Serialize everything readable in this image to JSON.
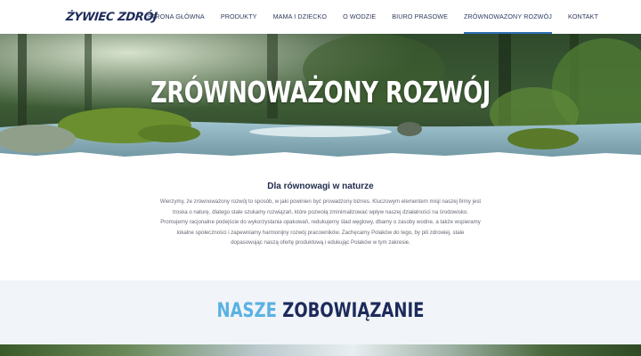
{
  "brand": {
    "logo_text": "ŻYWIEC ZDRÓJ"
  },
  "nav": {
    "items": [
      {
        "label": "STRONA GŁÓWNA",
        "active": false
      },
      {
        "label": "PRODUKTY",
        "active": false
      },
      {
        "label": "MAMA I DZIECKO",
        "active": false
      },
      {
        "label": "O WODZIE",
        "active": false
      },
      {
        "label": "BIURO PRASOWE",
        "active": false
      },
      {
        "label": "ZRÓWNOWAŻONY ROZWÓJ",
        "active": true
      },
      {
        "label": "KONTAKT",
        "active": false
      }
    ]
  },
  "hero": {
    "title": "ZRÓWNOWAŻONY ROZWÓJ"
  },
  "intro": {
    "heading": "Dla równowagi w naturze",
    "lines": [
      "Wierzymy, że zrównoważony rozwój to sposób, w jaki powinien być prowadzony biznes. Kluczowym elementem misji naszej firmy jest",
      "troska o naturę, dlatego stale szukamy rozwiązań, które pozwolą zminimalizować wpływ naszej działalności na środowisko.",
      "Promujemy racjonalne podejście do wykorzystania opakowań, redukujemy ślad węglowy, dbamy o zasoby wodne, a także wspieramy",
      "lokalne społeczności i zapewniamy harmonijny rozwój pracowników. Zachęcamy Polaków do tego, by pili zdrowiej, stale",
      "dopasowując naszą ofertę produktową i edukując Polaków w tym zakresie."
    ]
  },
  "commitment": {
    "word1": "NASZE",
    "word2": "ZOBOWIĄZANIE"
  },
  "colors": {
    "accent": "#2b6fb3",
    "navy": "#1c2b5a",
    "light_blue": "#5ab2e2",
    "section_bg": "#f1f4f8"
  }
}
